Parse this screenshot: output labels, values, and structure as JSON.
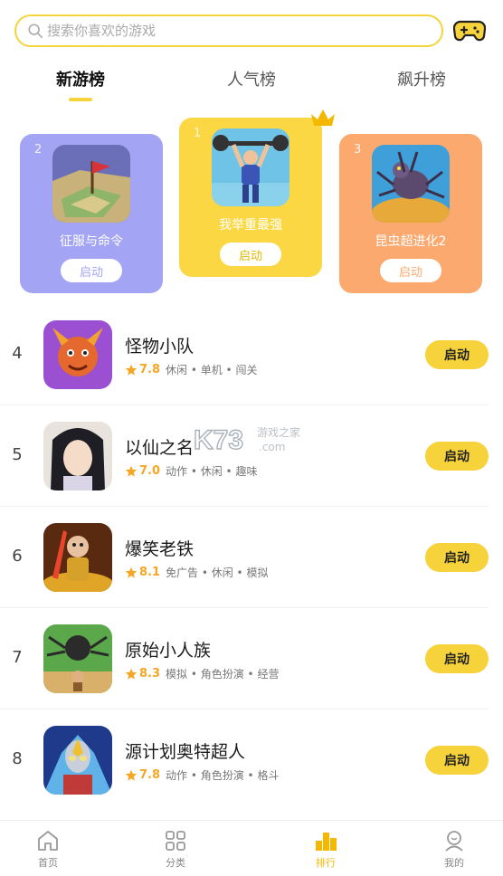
{
  "search": {
    "placeholder": "搜索你喜欢的游戏"
  },
  "header": {
    "gamepad_icon": "gamepad-icon"
  },
  "tabs": [
    {
      "label": "新游榜",
      "active": true
    },
    {
      "label": "人气榜",
      "active": false
    },
    {
      "label": "飙升榜",
      "active": false
    }
  ],
  "podium": [
    {
      "rank": "2",
      "name": "征服与命令",
      "button": "启动",
      "color": "#a3a4f3"
    },
    {
      "rank": "1",
      "name": "我举重最强",
      "button": "启动",
      "color": "#fbd843"
    },
    {
      "rank": "3",
      "name": "昆虫超进化2",
      "button": "启动",
      "color": "#fba96f"
    }
  ],
  "list": [
    {
      "rank": "4",
      "name": "怪物小队",
      "score": "7.8",
      "tags": "休闲 • 单机 • 闯关",
      "button": "启动"
    },
    {
      "rank": "5",
      "name": "以仙之名",
      "score": "7.0",
      "tags": "动作 • 休闲 • 趣味",
      "button": "启动"
    },
    {
      "rank": "6",
      "name": "爆笑老铁",
      "score": "8.1",
      "tags": "免广告 • 休闲 • 模拟",
      "button": "启动"
    },
    {
      "rank": "7",
      "name": "原始小人族",
      "score": "8.3",
      "tags": "模拟 • 角色扮演 • 经营",
      "button": "启动"
    },
    {
      "rank": "8",
      "name": "源计划奥特超人",
      "score": "7.8",
      "tags": "动作 • 角色扮演 • 格斗",
      "button": "启动"
    }
  ],
  "watermark": {
    "brand": "K73",
    "text1": "游戏之家",
    "text2": ".com"
  },
  "nav": [
    {
      "label": "首页",
      "icon": "home-icon",
      "active": false
    },
    {
      "label": "分类",
      "icon": "grid-icon",
      "active": false
    },
    {
      "label": "排行",
      "icon": "ranking-icon",
      "active": true
    },
    {
      "label": "我的",
      "icon": "user-icon",
      "active": false
    }
  ],
  "colors": {
    "accent": "#f7d33b",
    "star": "#f5a623"
  }
}
